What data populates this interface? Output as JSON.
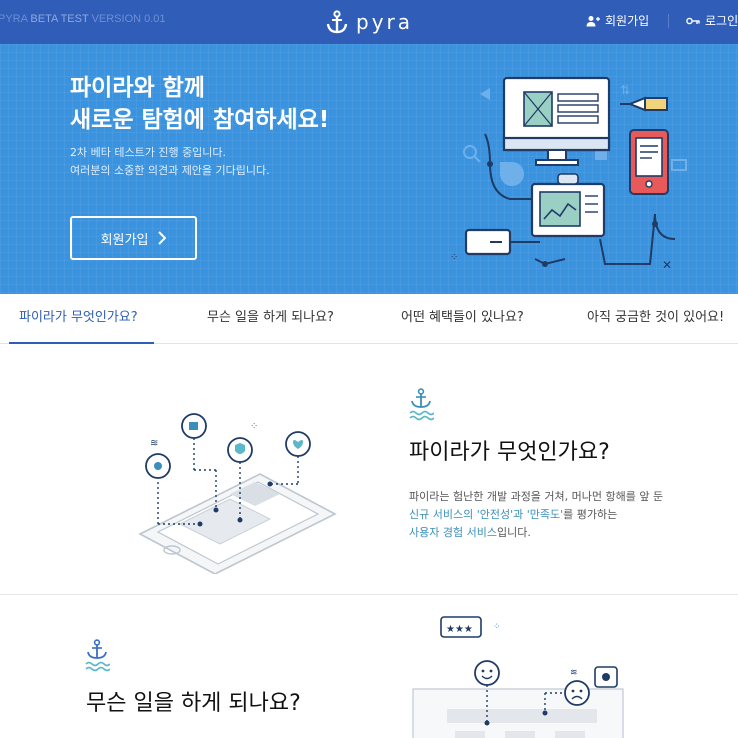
{
  "header": {
    "beta_brand": "PYRA",
    "beta_label": "BETA TEST",
    "version": "VERSION 0.01",
    "logo_text": "pyra",
    "join_label": "회원가입",
    "login_label": "로그인"
  },
  "hero": {
    "title_line1": "파이라와 함께",
    "title_line2": "새로운 탐험에 참여하세요!",
    "sub_line1": "2차 베타 테스트가 진행 중입니다.",
    "sub_line2": "여러분의 소중한 의견과 제안을 기다립니다.",
    "cta_label": "회원가입"
  },
  "tabs": [
    {
      "label": "파이라가 무엇인가요?",
      "active": true
    },
    {
      "label": "무슨 일을 하게 되나요?",
      "active": false
    },
    {
      "label": "어떤 혜택들이 있나요?",
      "active": false
    },
    {
      "label": "아직 궁금한 것이 있어요!",
      "active": false
    }
  ],
  "section1": {
    "title": "파이라가 무엇인가요?",
    "desc_line1": "파이라는 험난한 개발 과정을 거쳐, 머나먼 항해를 앞 둔",
    "desc_line2_hl1": "신규 서비스의 '안전성'과 '만족도'",
    "desc_line2_rest": "를 평가하는",
    "desc_line3_hl": "사용자 경험 서비스",
    "desc_line3_rest": "입니다."
  },
  "section2": {
    "title": "무슨 일을 하게 되나요?"
  },
  "colors": {
    "topbar": "#2f5db8",
    "hero": "#3a93de",
    "accent": "#2f5db8",
    "teal": "#3a8fb8"
  },
  "icons": {
    "join": "user-plus-icon",
    "login": "key-icon",
    "logo": "anchor-icon",
    "cta": "chevron-right-icon"
  }
}
